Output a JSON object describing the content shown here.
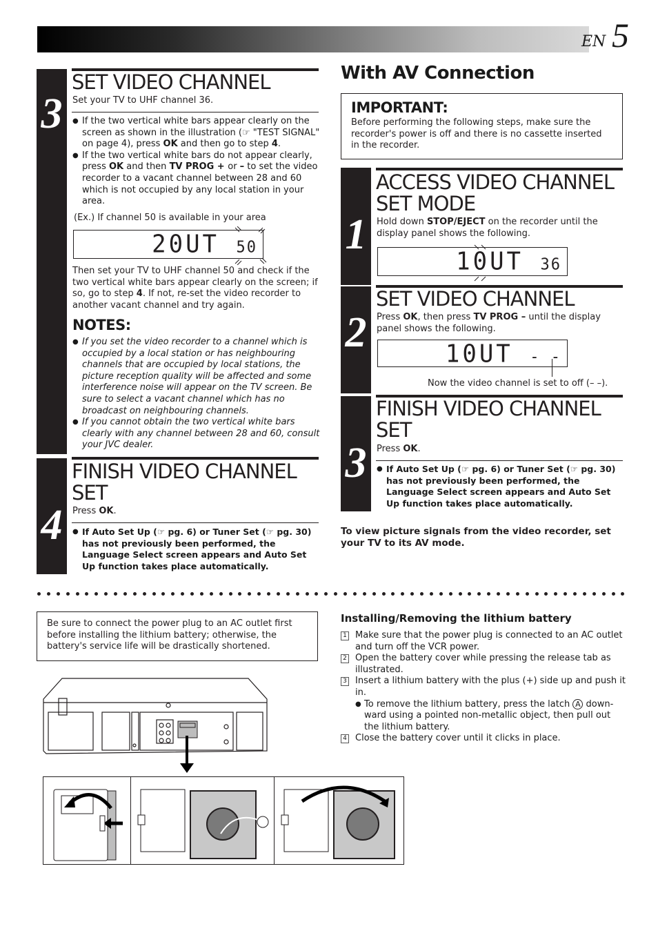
{
  "header": {
    "lang": "EN",
    "page_number": "5"
  },
  "left": {
    "step3": {
      "number": "3",
      "title": "SET VIDEO CHANNEL",
      "intro": "Set your TV to UHF channel 36.",
      "bullet1_a": "If the two vertical white bars appear clearly on the screen as shown in the illustration (☞ \"TEST SIGNAL\" on page 4), press ",
      "bullet1_ok": "OK",
      "bullet1_b": " and then go to step ",
      "bullet1_step": "4",
      "bullet1_c": ".",
      "bullet2_a": "If the two vertical white bars do not appear clearly, press ",
      "bullet2_ok": "OK",
      "bullet2_b": " and then ",
      "bullet2_key": "TV PROG + ",
      "bullet2_c": "or ",
      "bullet2_minus": "–",
      "bullet2_d": " to set the video recorder to a vacant channel between 28 and 60 which is not occupied by any local station in your area.",
      "example": "(Ex.) If channel 50 is available in your area",
      "display_main": "20UT",
      "display_channel": "50",
      "after_a": "Then set your TV to UHF channel 50 and check if the two vertical white bars appear clearly on the screen; if so, go to step ",
      "after_step": "4",
      "after_b": ". If not, re-set the video recorder to another vacant channel and try again."
    },
    "notes": {
      "title": "NOTES:",
      "items": [
        "If you set the video recorder to a channel which is occupied by a local station or has neighbouring channels that are occupied by local stations, the picture reception quality will be affected and some interference noise will appear on the TV screen. Be sure to select a vacant channel which has no broadcast on neighbouring channels.",
        "If you cannot obtain the two vertical white bars clearly with any channel between 28 and 60, consult your JVC dealer."
      ]
    },
    "step4": {
      "number": "4",
      "title_line1": "FINISH VIDEO CHANNEL",
      "title_line2": "SET",
      "press": "Press ",
      "ok": "OK",
      "period": ".",
      "bullet": "If Auto Set Up (☞ pg. 6) or Tuner Set (☞ pg. 30) has not previously been performed, the Language Select screen appears and Auto Set Up function takes place automatically."
    }
  },
  "right": {
    "title": "With AV Connection",
    "important": {
      "title": "IMPORTANT:",
      "text": "Before performing the following steps, make sure the recorder's power is off and there is no cassette inserted in the recorder."
    },
    "step1": {
      "number": "1",
      "title_line1": "ACCESS VIDEO CHANNEL",
      "title_line2": "SET MODE",
      "text_a": "Hold down ",
      "key": "STOP/EJECT",
      "text_b": " on the recorder until the display panel shows the following.",
      "display_main": "10UT",
      "display_channel": "36"
    },
    "step2": {
      "number": "2",
      "title": "SET VIDEO CHANNEL",
      "text_a": "Press ",
      "ok": "OK",
      "text_b": ", then press ",
      "key": "TV PROG –",
      "text_c": " until the display panel shows the following.",
      "display_main": "10UT",
      "display_channel": "- -",
      "caption": "Now the video channel is set to off (– –)."
    },
    "step3": {
      "number": "3",
      "title_line1": "FINISH VIDEO CHANNEL",
      "title_line2": "SET",
      "press": "Press ",
      "ok": "OK",
      "period": ".",
      "bullet": "If Auto Set Up (☞ pg. 6) or Tuner Set (☞ pg. 30) has not previously been performed, the Language Select screen appears and Auto Set Up function takes place automatically."
    },
    "av_note": "To view picture signals from the video recorder, set your TV to its AV mode."
  },
  "battery": {
    "warning": "Be sure to connect the power plug to an AC outlet first before installing the lithium battery; otherwise, the battery's service life will be drastically shortened.",
    "title": "Installing/Removing the lithium battery",
    "steps": [
      {
        "num": "1",
        "text": "Make sure that the power plug is connected to an AC outlet and turn off the VCR power."
      },
      {
        "num": "2",
        "text": "Open the battery cover while pressing the release tab as illustrated."
      },
      {
        "num": "3",
        "text": "Insert a lithium battery with the plus (+) side up and push it in."
      },
      {
        "num": "4",
        "text": "Close the battery cover until it clicks in place."
      }
    ],
    "sub_a": "To remove the lithium battery, press the latch ",
    "latch_label": "A",
    "sub_b": " down-ward using a pointed non-metallic object, then pull out the lithium battery."
  }
}
